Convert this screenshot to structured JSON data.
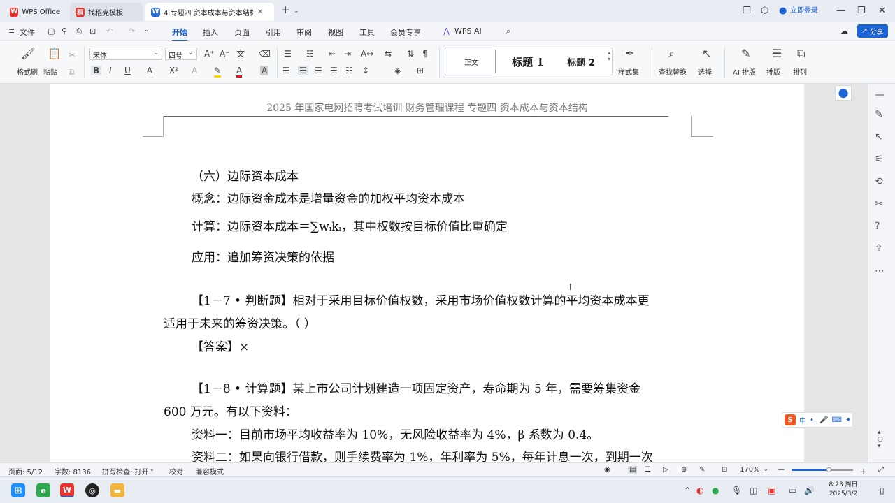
{
  "titlebar": {
    "tabs": [
      {
        "label": "WPS Office"
      },
      {
        "label": "找稻壳模板"
      },
      {
        "label": "4.专题四  资本成本与资本结构"
      }
    ],
    "login_label": "立即登录"
  },
  "menubar": {
    "file_label": "文件",
    "items": [
      "开始",
      "插入",
      "页面",
      "引用",
      "审阅",
      "视图",
      "工具",
      "会员专享",
      "WPS AI"
    ],
    "share_label": "分享"
  },
  "ribbon": {
    "format_painter": "格式刷",
    "paste": "粘贴",
    "font_name": "宋体",
    "font_size": "四号",
    "styles": [
      "正文",
      "标题  1",
      "标题  2"
    ],
    "style_set": "样式集",
    "find_replace": "查找替换",
    "select": "选择",
    "ai_layout": "AI 排版",
    "layout": "排版",
    "arrange": "排列"
  },
  "document": {
    "header": "2025 年国家电网招聘考试培训    财务管理课程    专题四  资本成本与资本结构",
    "lines": [
      "（六）边际资本成本",
      "概念：边际资金成本是增量资金的加权平均资本成本",
      "计算：边际资本成本＝∑wᵢkᵢ，其中权数按目标价值比重确定",
      "应用：追加筹资决策的依据",
      "【1－7 • 判断题】相对于采用目标价值权数，采用市场价值权数计算的平均资本成本更",
      "适用于未来的筹资决策。（    ）",
      "【答案】×",
      "【1－8 • 计算题】某上市公司计划建造一项固定资产，寿命期为 5 年，需要筹集资金",
      "600 万元。有以下资料：",
      "资料一：目前市场平均收益率为 10%，无风险收益率为 4%，β 系数为 0.4。",
      "资料二：如果向银行借款，则手续费率为 1%，年利率为 5%，每年计息一次，到期一次"
    ]
  },
  "statusbar": {
    "page": "页面: 5/12",
    "words": "字数: 8136",
    "spell": "拼写检查: 打开",
    "proof": "校对",
    "compat": "兼容模式",
    "zoom": "170%"
  },
  "taskbar": {
    "time": "8:23 周日",
    "date": "2025/3/2"
  },
  "colors": {
    "accent": "#1b64d8",
    "wps_red": "#e8322c",
    "share_bg": "#1b64d8"
  }
}
